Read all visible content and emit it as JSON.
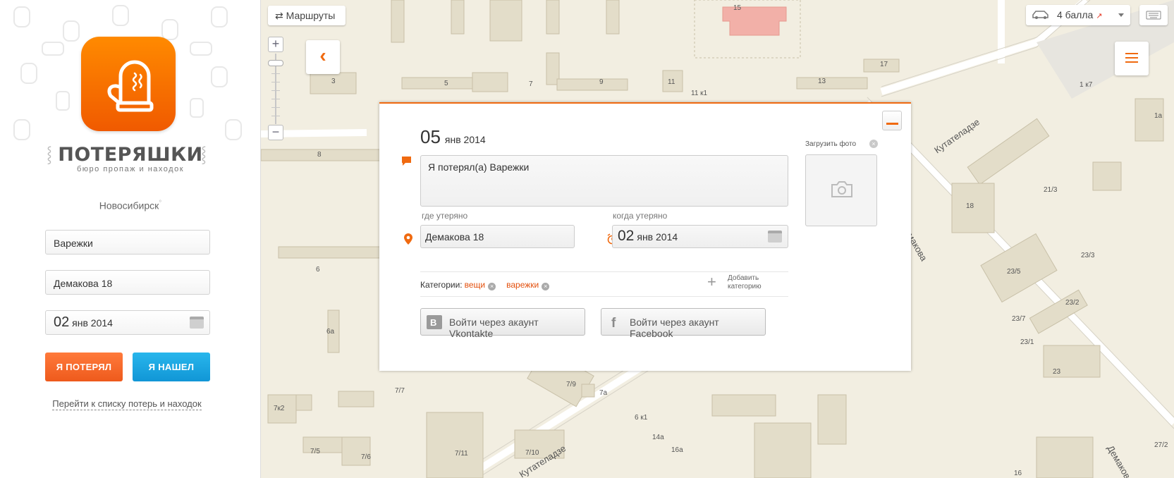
{
  "sidebar": {
    "brand_name": "ПОТЕРЯШКИ",
    "brand_tagline": "бюро пропаж и находок",
    "city": "Новосибирск",
    "city_marker": "°",
    "what_value": "Варежки",
    "where_value": "Демакова 18",
    "date_day": "02",
    "date_month_year": "янв 2014",
    "lost_button": "Я ПОТЕРЯЛ",
    "found_button": "Я НАШЕЛ",
    "list_link": "Перейти к списку потерь и находок"
  },
  "map": {
    "routes_button": "Маршруты",
    "traffic_label": "4 балла",
    "labels": [
      "15",
      "3",
      "5",
      "7",
      "9",
      "11",
      "11 к1",
      "13",
      "17",
      "1 к7",
      "1а",
      "8",
      "6",
      "6а",
      "7к2",
      "7/7",
      "7/9",
      "7а",
      "7/5",
      "7/6",
      "7/11",
      "7/10",
      "6 к1",
      "14а",
      "16а",
      "16",
      "18",
      "21/3",
      "23/3",
      "23/5",
      "23/2",
      "23/7",
      "23/1",
      "23",
      "27/2",
      "Кутателадзе",
      "Демакова",
      "Кутателадзе",
      "Демаков"
    ]
  },
  "popup": {
    "date_day": "05",
    "date_month_year": "янв 2014",
    "message": "Я потерял(а)  Варежки",
    "where_label": "где утеряно",
    "where_value": "Демакова 18",
    "when_label": "когда утеряно",
    "when_day": "02",
    "when_month_year": "янв  2014",
    "categories_label": "Категории:",
    "categories": [
      "вещи",
      "варежки"
    ],
    "add_category": [
      "Добавить",
      "категорию"
    ],
    "vk_button": "Войти через акаунт Vkontakte",
    "fb_button": "Войти через акаунт Facebook",
    "upload_label": "Загрузить фото"
  },
  "colors": {
    "accent": "#f06a10",
    "lost_button": "#ee5a1c",
    "found_button": "#1196d6",
    "category_text": "#e34f0c"
  }
}
